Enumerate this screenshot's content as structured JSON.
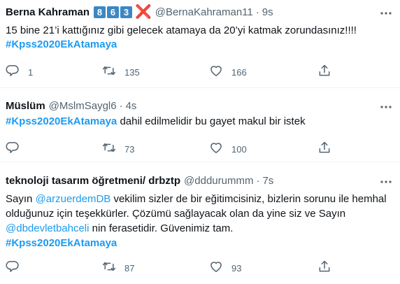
{
  "tweets": [
    {
      "name": "Berna Kahraman",
      "badges": [
        "8",
        "6",
        "3"
      ],
      "badge_cross": "❌",
      "handle": "@BernaKahraman11",
      "separator": "·",
      "time": "9s",
      "text": "15 bine 21’i kattığınız gibi gelecek atamaya da 20’yi katmak zorundasınız!!!!",
      "hashtag": "#Kpss2020EkAtamaya",
      "replies": "1",
      "retweets": "135",
      "likes": "166"
    },
    {
      "name": "Müslüm",
      "handle": "@MslmSaygl6",
      "separator": "·",
      "time": "4s",
      "hashtag": "#Kpss2020EkAtamaya",
      "text_after": " dahil edilmelidir bu gayet makul bir istek",
      "replies": "",
      "retweets": "73",
      "likes": "100"
    },
    {
      "name": "teknoloji tasarım öğretmeni/ drbztp",
      "handle": "@dddurummm",
      "separator": "·",
      "time": "7s",
      "text_p1": "Sayın ",
      "mention1": "@arzuerdemDB",
      "text_p2": " vekilim sizler de bir eğitimcisiniz, bizlerin sorunu ile hemhal olduğunuz için teşekkürler. Çözümü sağlayacak olan da yine siz ve Sayın ",
      "mention2": "@dbdevletbahceli",
      "text_p3": " nin ferasetidir. Güvenimiz tam.",
      "hashtag": "#Kpss2020EkAtamaya",
      "replies": "",
      "retweets": "87",
      "likes": "93"
    }
  ],
  "icons": {
    "reply": "reply-icon",
    "retweet": "retweet-icon",
    "like": "heart-icon",
    "share": "share-icon",
    "more": "more-icon"
  }
}
